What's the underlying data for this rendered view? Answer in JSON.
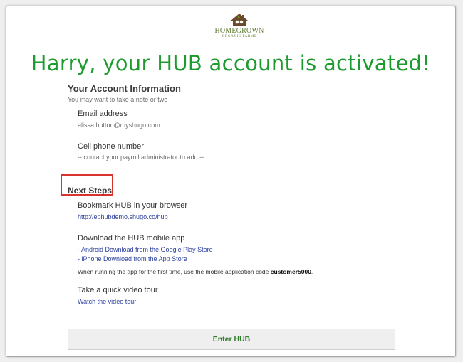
{
  "logo": {
    "line1": "HOMEGROWN",
    "line2": "ORGANIC FARMS"
  },
  "headline": "Harry, your HUB account is activated!",
  "account": {
    "title": "Your Account Information",
    "subtitle": "You may want to take a note or two",
    "email_label": "Email address",
    "email_value": "alissa.hutton@myshugo.com",
    "phone_label": "Cell phone number",
    "phone_value": "-- contact your payroll administrator to add --"
  },
  "next_steps": {
    "title": "Next Steps",
    "bookmark_label": "Bookmark HUB in your browser",
    "bookmark_link": "http://ephubdemo.shugo.co/hub",
    "app_label": "Download the HUB mobile app",
    "android_link": "- Android Download from the Google Play Store",
    "iphone_link": "- iPhone Download from the App Store",
    "app_note_prefix": "When running the app for the first time, use the mobile application code ",
    "app_code": "customer5000",
    "app_note_suffix": ".",
    "video_label": "Take a quick video tour",
    "video_link": "Watch the video tour"
  },
  "enter_button": "Enter HUB",
  "colors": {
    "headline": "#1e9b2e",
    "link": "#2b3f9e",
    "highlight_box": "#d9332f",
    "button_text": "#2d7a27"
  }
}
